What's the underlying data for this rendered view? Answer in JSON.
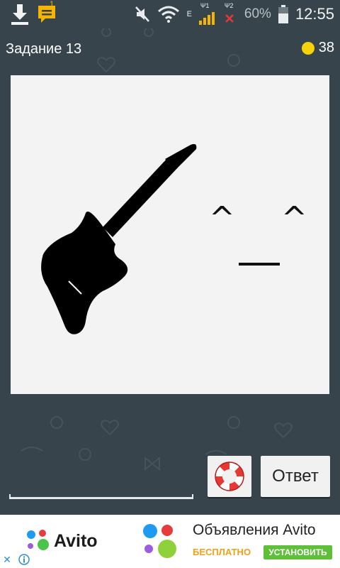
{
  "status_bar": {
    "notification_count": "1",
    "sim1_label": "Ψ1",
    "sim2_label": "Ψ2",
    "network_type": "E",
    "battery_percent": "60%",
    "time": "12:55"
  },
  "header": {
    "task_title": "Задание 13",
    "coins": "38"
  },
  "puzzle": {
    "face_left_eye": "^",
    "face_right_eye": "^",
    "icons": [
      "guitar-icon"
    ]
  },
  "controls": {
    "answer_button": "Ответ",
    "help_icon": "lifebuoy-icon"
  },
  "ad": {
    "brand": "Avito",
    "title": "Объявления Avito",
    "free_label": "БЕСПЛАТНО",
    "install_label": "УСТАНОВИТЬ"
  },
  "colors": {
    "background": "#37444b",
    "card": "#f3f3f3",
    "coin": "#f5d20a",
    "install_green": "#5fbf3a",
    "free_orange": "#f0a118"
  }
}
